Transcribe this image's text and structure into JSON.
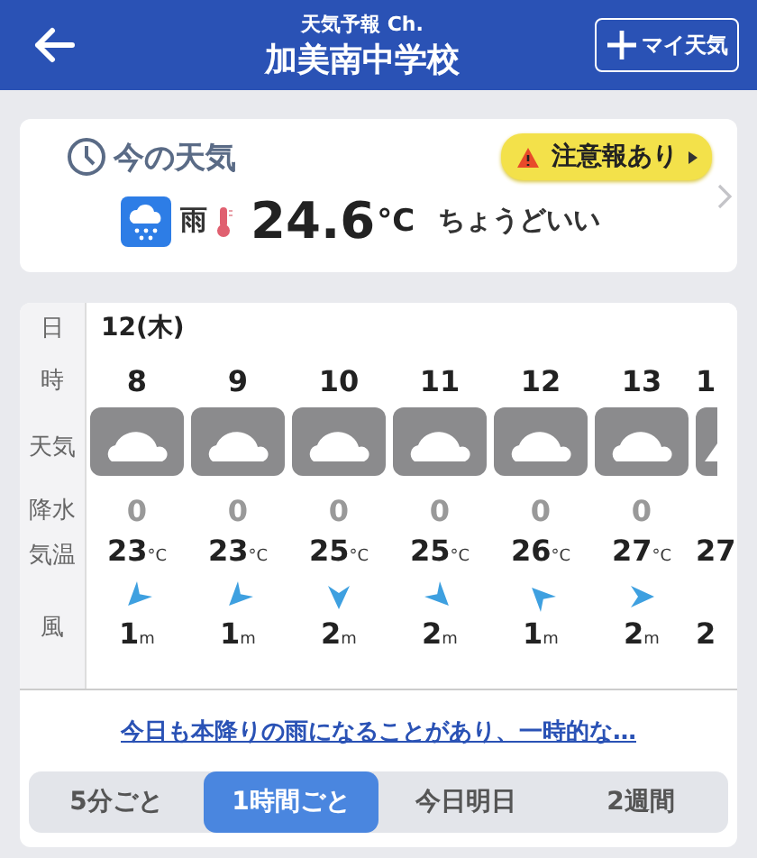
{
  "header": {
    "subtitle": "天気予報 Ch.",
    "title": "加美南中学校",
    "add_button": "マイ天気"
  },
  "current": {
    "heading": "今の天気",
    "alert": "注意報あり",
    "condition": "雨",
    "temperature": "24.6",
    "unit": "°C",
    "feeling": "ちょうどいい"
  },
  "forecast": {
    "labels": {
      "date": "日",
      "hour": "時",
      "weather": "天気",
      "precip": "降水",
      "temp": "気温",
      "wind": "風"
    },
    "date": "12(木)",
    "columns": [
      {
        "kind": "full",
        "hour": "8",
        "precip": "0",
        "temp": "23",
        "temp_unit": "°C",
        "wind_arrow": {
          "kind": "southwest"
        },
        "wind_speed": "1",
        "wind_unit": "m"
      },
      {
        "kind": "full",
        "hour": "9",
        "precip": "0",
        "temp": "23",
        "temp_unit": "°C",
        "wind_arrow": {
          "kind": "southwest"
        },
        "wind_speed": "1",
        "wind_unit": "m"
      },
      {
        "kind": "full",
        "hour": "10",
        "precip": "0",
        "temp": "25",
        "temp_unit": "°C",
        "wind_arrow": {
          "kind": "south"
        },
        "wind_speed": "2",
        "wind_unit": "m"
      },
      {
        "kind": "full",
        "hour": "11",
        "precip": "0",
        "temp": "25",
        "temp_unit": "°C",
        "wind_arrow": {
          "kind": "southeast"
        },
        "wind_speed": "2",
        "wind_unit": "m"
      },
      {
        "kind": "full",
        "hour": "12",
        "precip": "0",
        "temp": "26",
        "temp_unit": "°C",
        "wind_arrow": {
          "kind": "northwest"
        },
        "wind_speed": "1",
        "wind_unit": "m"
      },
      {
        "kind": "full",
        "hour": "13",
        "precip": "0",
        "temp": "27",
        "temp_unit": "°C",
        "wind_arrow": {
          "kind": "east"
        },
        "wind_speed": "2",
        "wind_unit": "m"
      },
      {
        "kind": "partial",
        "hour": "1",
        "temp": "27",
        "wind_speed": "2"
      }
    ]
  },
  "summary_link": "今日も本降りの雨になることがあり、一時的な…",
  "tabs": [
    {
      "label": "5分ごと",
      "selected": false
    },
    {
      "label": "1時間ごと",
      "selected": true
    },
    {
      "label": "今日明日",
      "selected": false
    },
    {
      "label": "2週間",
      "selected": false
    }
  ]
}
